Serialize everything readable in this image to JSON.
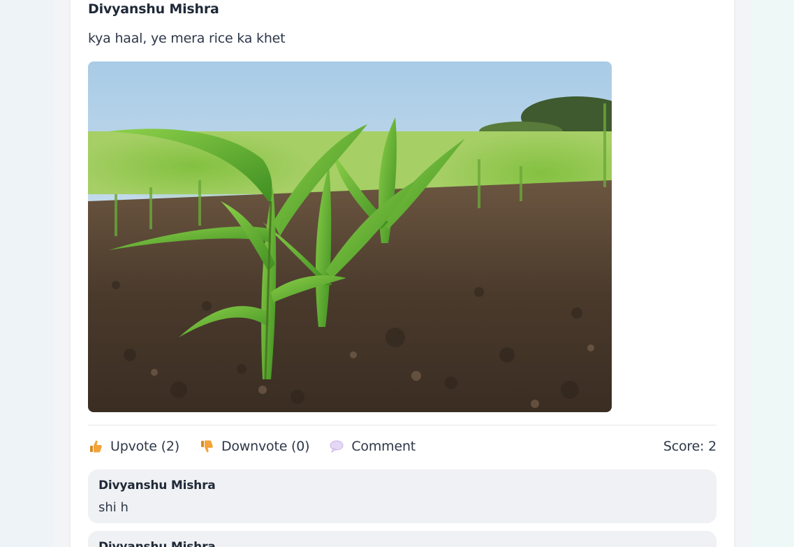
{
  "post": {
    "author": "Divyanshu Mishra",
    "text": "kya haal, ye mera rice ka khet",
    "image_icon": "crop-field-photo"
  },
  "actions": {
    "upvote_label": "Upvote (2)",
    "downvote_label": "Downvote (0)",
    "comment_label": "Comment",
    "score_label": "Score: 2",
    "upvote_icon": "thumbs-up-icon",
    "downvote_icon": "thumbs-down-icon",
    "comment_icon": "speech-bubble-icon"
  },
  "comments": [
    {
      "author": "Divyanshu Mishra",
      "text": "shi h"
    },
    {
      "author": "Divyanshu Mishra",
      "text": ""
    }
  ],
  "colors": {
    "thumb": "#f2a33a",
    "bubble": "#d8c8f0",
    "card": "#ffffff",
    "comment_bg": "#f0f1f4"
  }
}
